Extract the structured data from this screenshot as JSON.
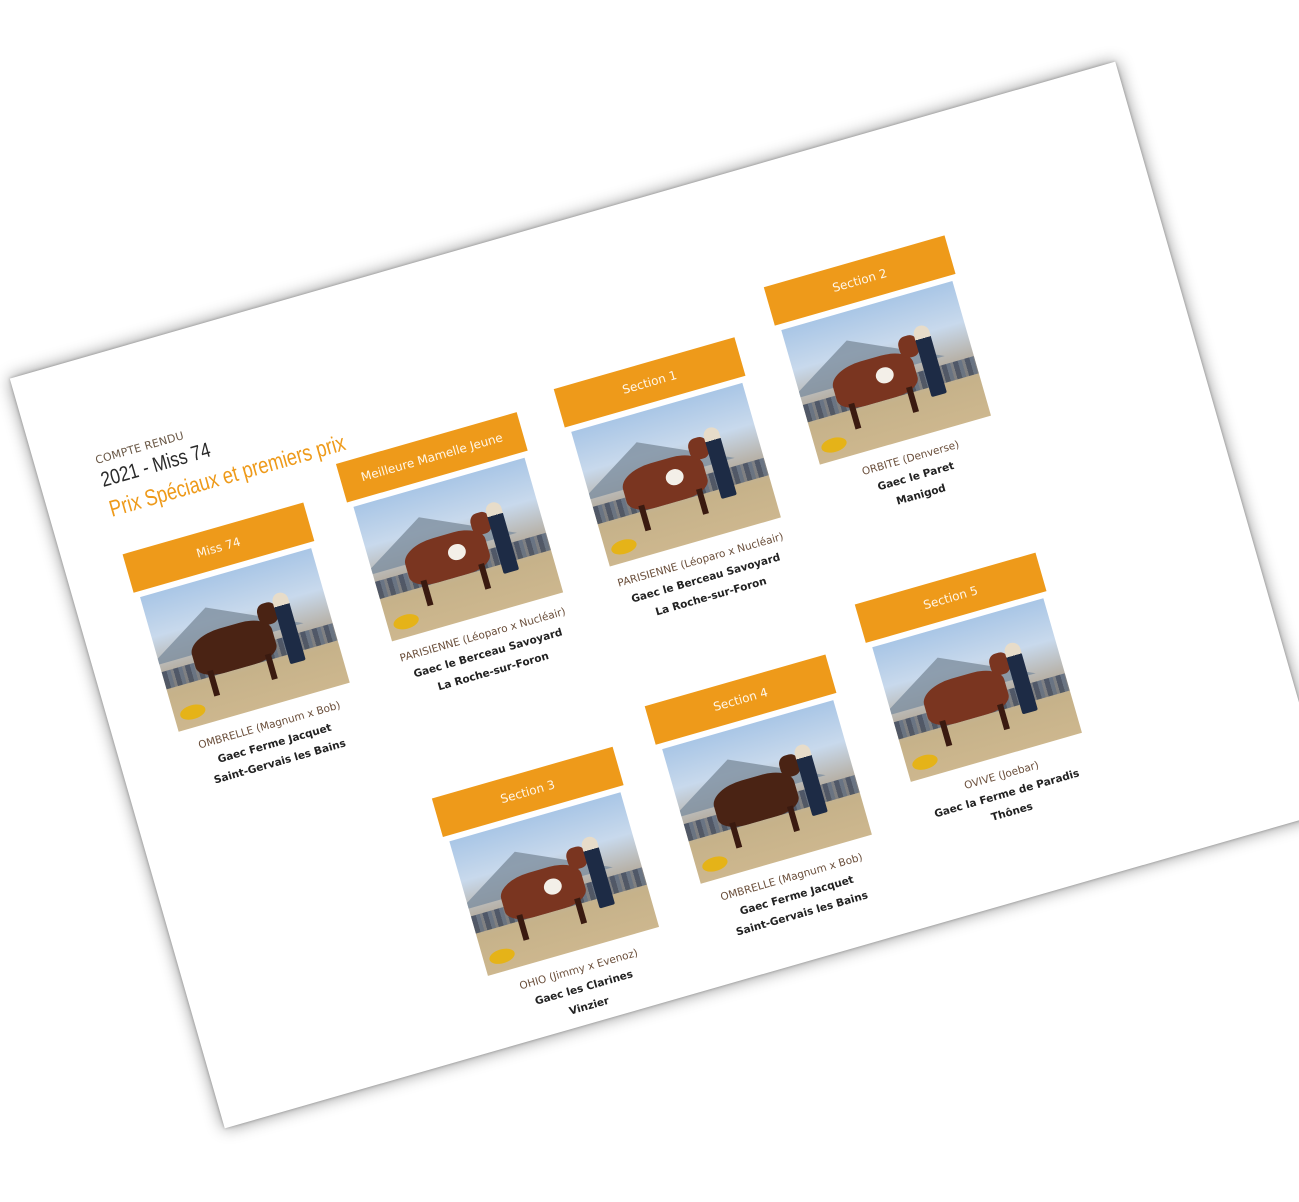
{
  "header": {
    "kicker": "COMPTE RENDU",
    "title": "2021 - Miss 74",
    "subtitle": "Prix Spéciaux et premiers prix"
  },
  "colors": {
    "accent": "#ee9a1a"
  },
  "cards": [
    {
      "header": "Miss 74",
      "animal": "OMBRELLE (Magnum x Bob)",
      "owner": "Gaec Ferme Jacquet",
      "town": "Saint-Gervais les Bains"
    },
    {
      "header": "Meilleure Mamelle Jeune",
      "animal": "PARISIENNE (Léoparo x Nucléair)",
      "owner": "Gaec le Berceau Savoyard",
      "town": "La Roche-sur-Foron"
    },
    {
      "header": "Section 1",
      "animal": "PARISIENNE (Léoparo x Nucléair)",
      "owner": "Gaec le Berceau Savoyard",
      "town": "La Roche-sur-Foron"
    },
    {
      "header": "Section 2",
      "animal": "ORBITE (Denverse)",
      "owner": "Gaec le Paret",
      "town": "Manigod"
    },
    {
      "header": "Section 3",
      "animal": "OHIO (Jimmy x Evenoz)",
      "owner": "Gaec les Clarines",
      "town": "Vinzier"
    },
    {
      "header": "Section 4",
      "animal": "OMBRELLE (Magnum x Bob)",
      "owner": "Gaec Ferme Jacquet",
      "town": "Saint-Gervais les Bains"
    },
    {
      "header": "Section 5",
      "animal": "OVIVE (Joebar)",
      "owner": "Gaec la Ferme de Paradis",
      "town": "Thônes"
    }
  ]
}
